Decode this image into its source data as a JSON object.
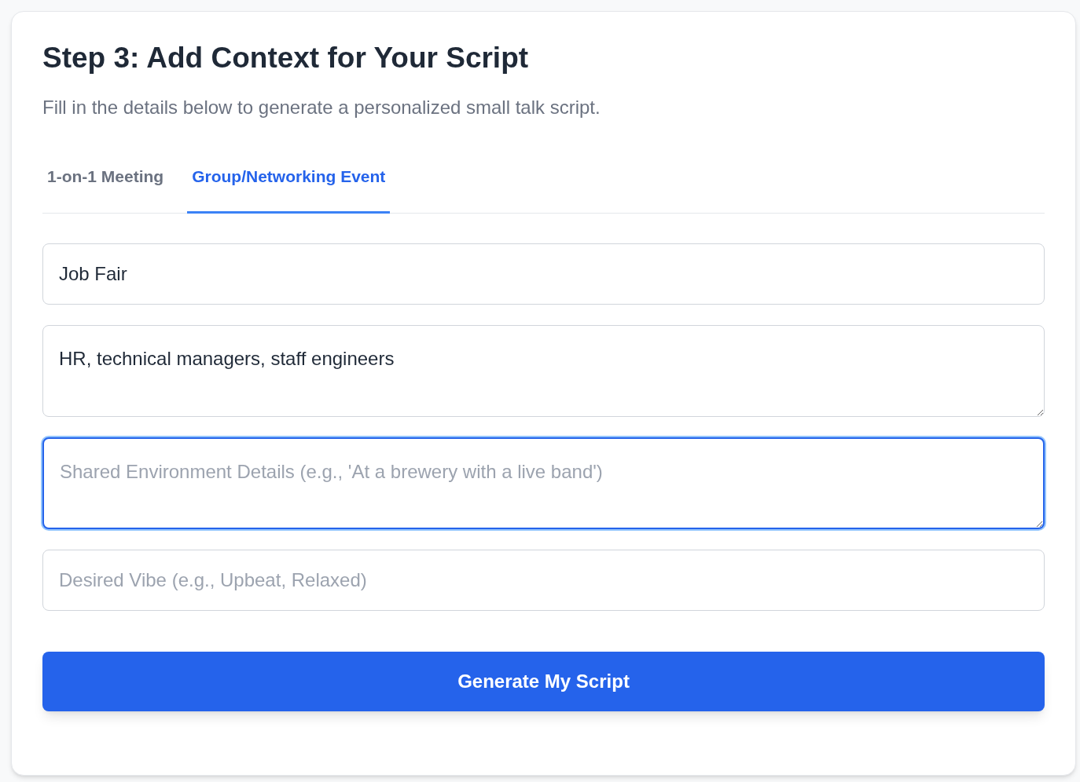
{
  "title": "Step 3: Add Context for Your Script",
  "subtitle": "Fill in the details below to generate a personalized small talk script.",
  "tabs": [
    {
      "label": "1-on-1 Meeting",
      "selected": false
    },
    {
      "label": "Group/Networking Event",
      "selected": true
    }
  ],
  "fields": [
    {
      "kind": "input",
      "value": "Job Fair",
      "focused": false
    },
    {
      "kind": "textarea",
      "value": "HR, technical managers, staff engineers",
      "focused": false
    },
    {
      "kind": "textarea",
      "placeholder": "Shared Environment Details (e.g., 'At a brewery with a live band')",
      "focused": true
    },
    {
      "kind": "input",
      "placeholder": "Desired Vibe (e.g., Upbeat, Relaxed)",
      "focused": false
    }
  ],
  "button": "Generate My Script"
}
